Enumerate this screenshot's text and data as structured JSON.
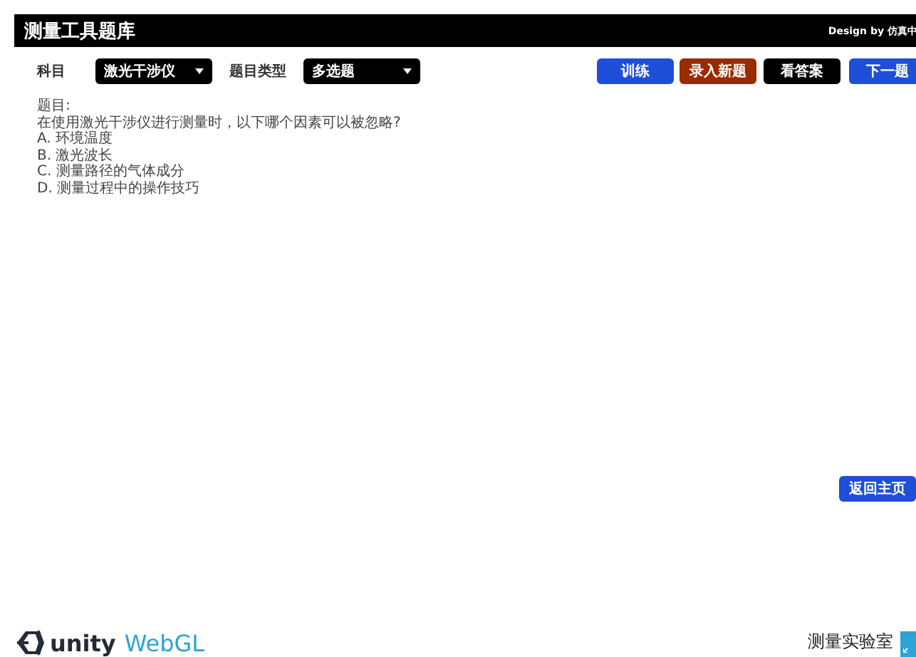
{
  "header": {
    "title": "测量工具题库",
    "credit": "Design by 仿真中"
  },
  "filters": [
    {
      "label": "科目",
      "value": "激光干涉仪"
    },
    {
      "label": "题目类型",
      "value": "多选题"
    }
  ],
  "buttons": [
    {
      "label": "训练",
      "color": "#1f4fd8"
    },
    {
      "label": "录入新题",
      "color": "#992b00"
    },
    {
      "label": "看答案",
      "color": "#000000"
    },
    {
      "label": "下一题",
      "color": "#1f4fd8"
    }
  ],
  "question": {
    "heading": "题目:",
    "stem": "在使用激光干涉仪进行测量时，以下哪个因素可以被忽略?",
    "options": [
      "A. 环境温度",
      "B. 激光波长",
      "C. 测量路径的气体成分",
      "D. 测量过程中的操作技巧"
    ]
  },
  "back_button": {
    "label": "返回主页"
  },
  "footer": {
    "brand": "unity",
    "product": "WebGL",
    "site": "测量实验室"
  }
}
